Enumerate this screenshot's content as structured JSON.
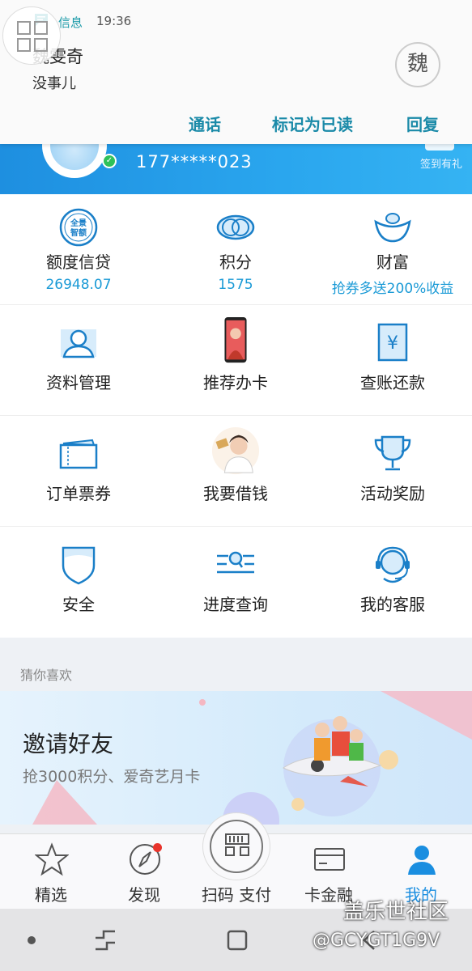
{
  "notification": {
    "app_name": "信息",
    "time": "19:36",
    "sender": "魏雯奇",
    "message": "没事儿",
    "avatar_char": "魏",
    "actions": [
      "通话",
      "标记为已读",
      "回复"
    ]
  },
  "profile": {
    "phone": "177*****023",
    "sign_in_gift": "签到有礼"
  },
  "grid": {
    "row1": [
      {
        "label": "额度信贷",
        "value": "26948.07",
        "icon": "panorama-credit-icon"
      },
      {
        "label": "积分",
        "value": "1575",
        "icon": "points-rings-icon"
      },
      {
        "label": "财富",
        "value": "抢券多送200%收益",
        "icon": "ingot-icon"
      }
    ],
    "row2": [
      {
        "label": "资料管理",
        "icon": "user-profile-icon"
      },
      {
        "label": "推荐办卡",
        "icon": "phone-image-icon"
      },
      {
        "label": "查账还款",
        "icon": "bill-yen-icon"
      }
    ],
    "row3": [
      {
        "label": "订单票券",
        "icon": "ticket-icon"
      },
      {
        "label": "我要借钱",
        "icon": "person-photo-icon"
      },
      {
        "label": "活动奖励",
        "icon": "trophy-icon"
      }
    ],
    "row4": [
      {
        "label": "安全",
        "icon": "shield-icon"
      },
      {
        "label": "进度查询",
        "icon": "progress-search-icon"
      },
      {
        "label": "我的客服",
        "icon": "headset-icon"
      }
    ]
  },
  "recommend": {
    "title": "猜你喜欢",
    "banner_title": "邀请好友",
    "banner_subtitle": "抢3000积分、爱奇艺月卡"
  },
  "bottom_nav": [
    {
      "label": "精选",
      "icon": "star-icon"
    },
    {
      "label": "发现",
      "icon": "compass-icon"
    },
    {
      "label": "扫码 支付",
      "icon": "scan-qr-icon"
    },
    {
      "label": "卡金融",
      "icon": "card-icon"
    },
    {
      "label": "我的",
      "icon": "person-icon",
      "active": true
    }
  ],
  "watermark": {
    "line1": "盖乐世社区",
    "line2": "@GCYGT1G9V"
  },
  "colors": {
    "accent_blue": "#1a8ee0",
    "notif_teal": "#1a8aa8",
    "value_blue": "#1a9ad6",
    "badge_red": "#e8342c"
  }
}
